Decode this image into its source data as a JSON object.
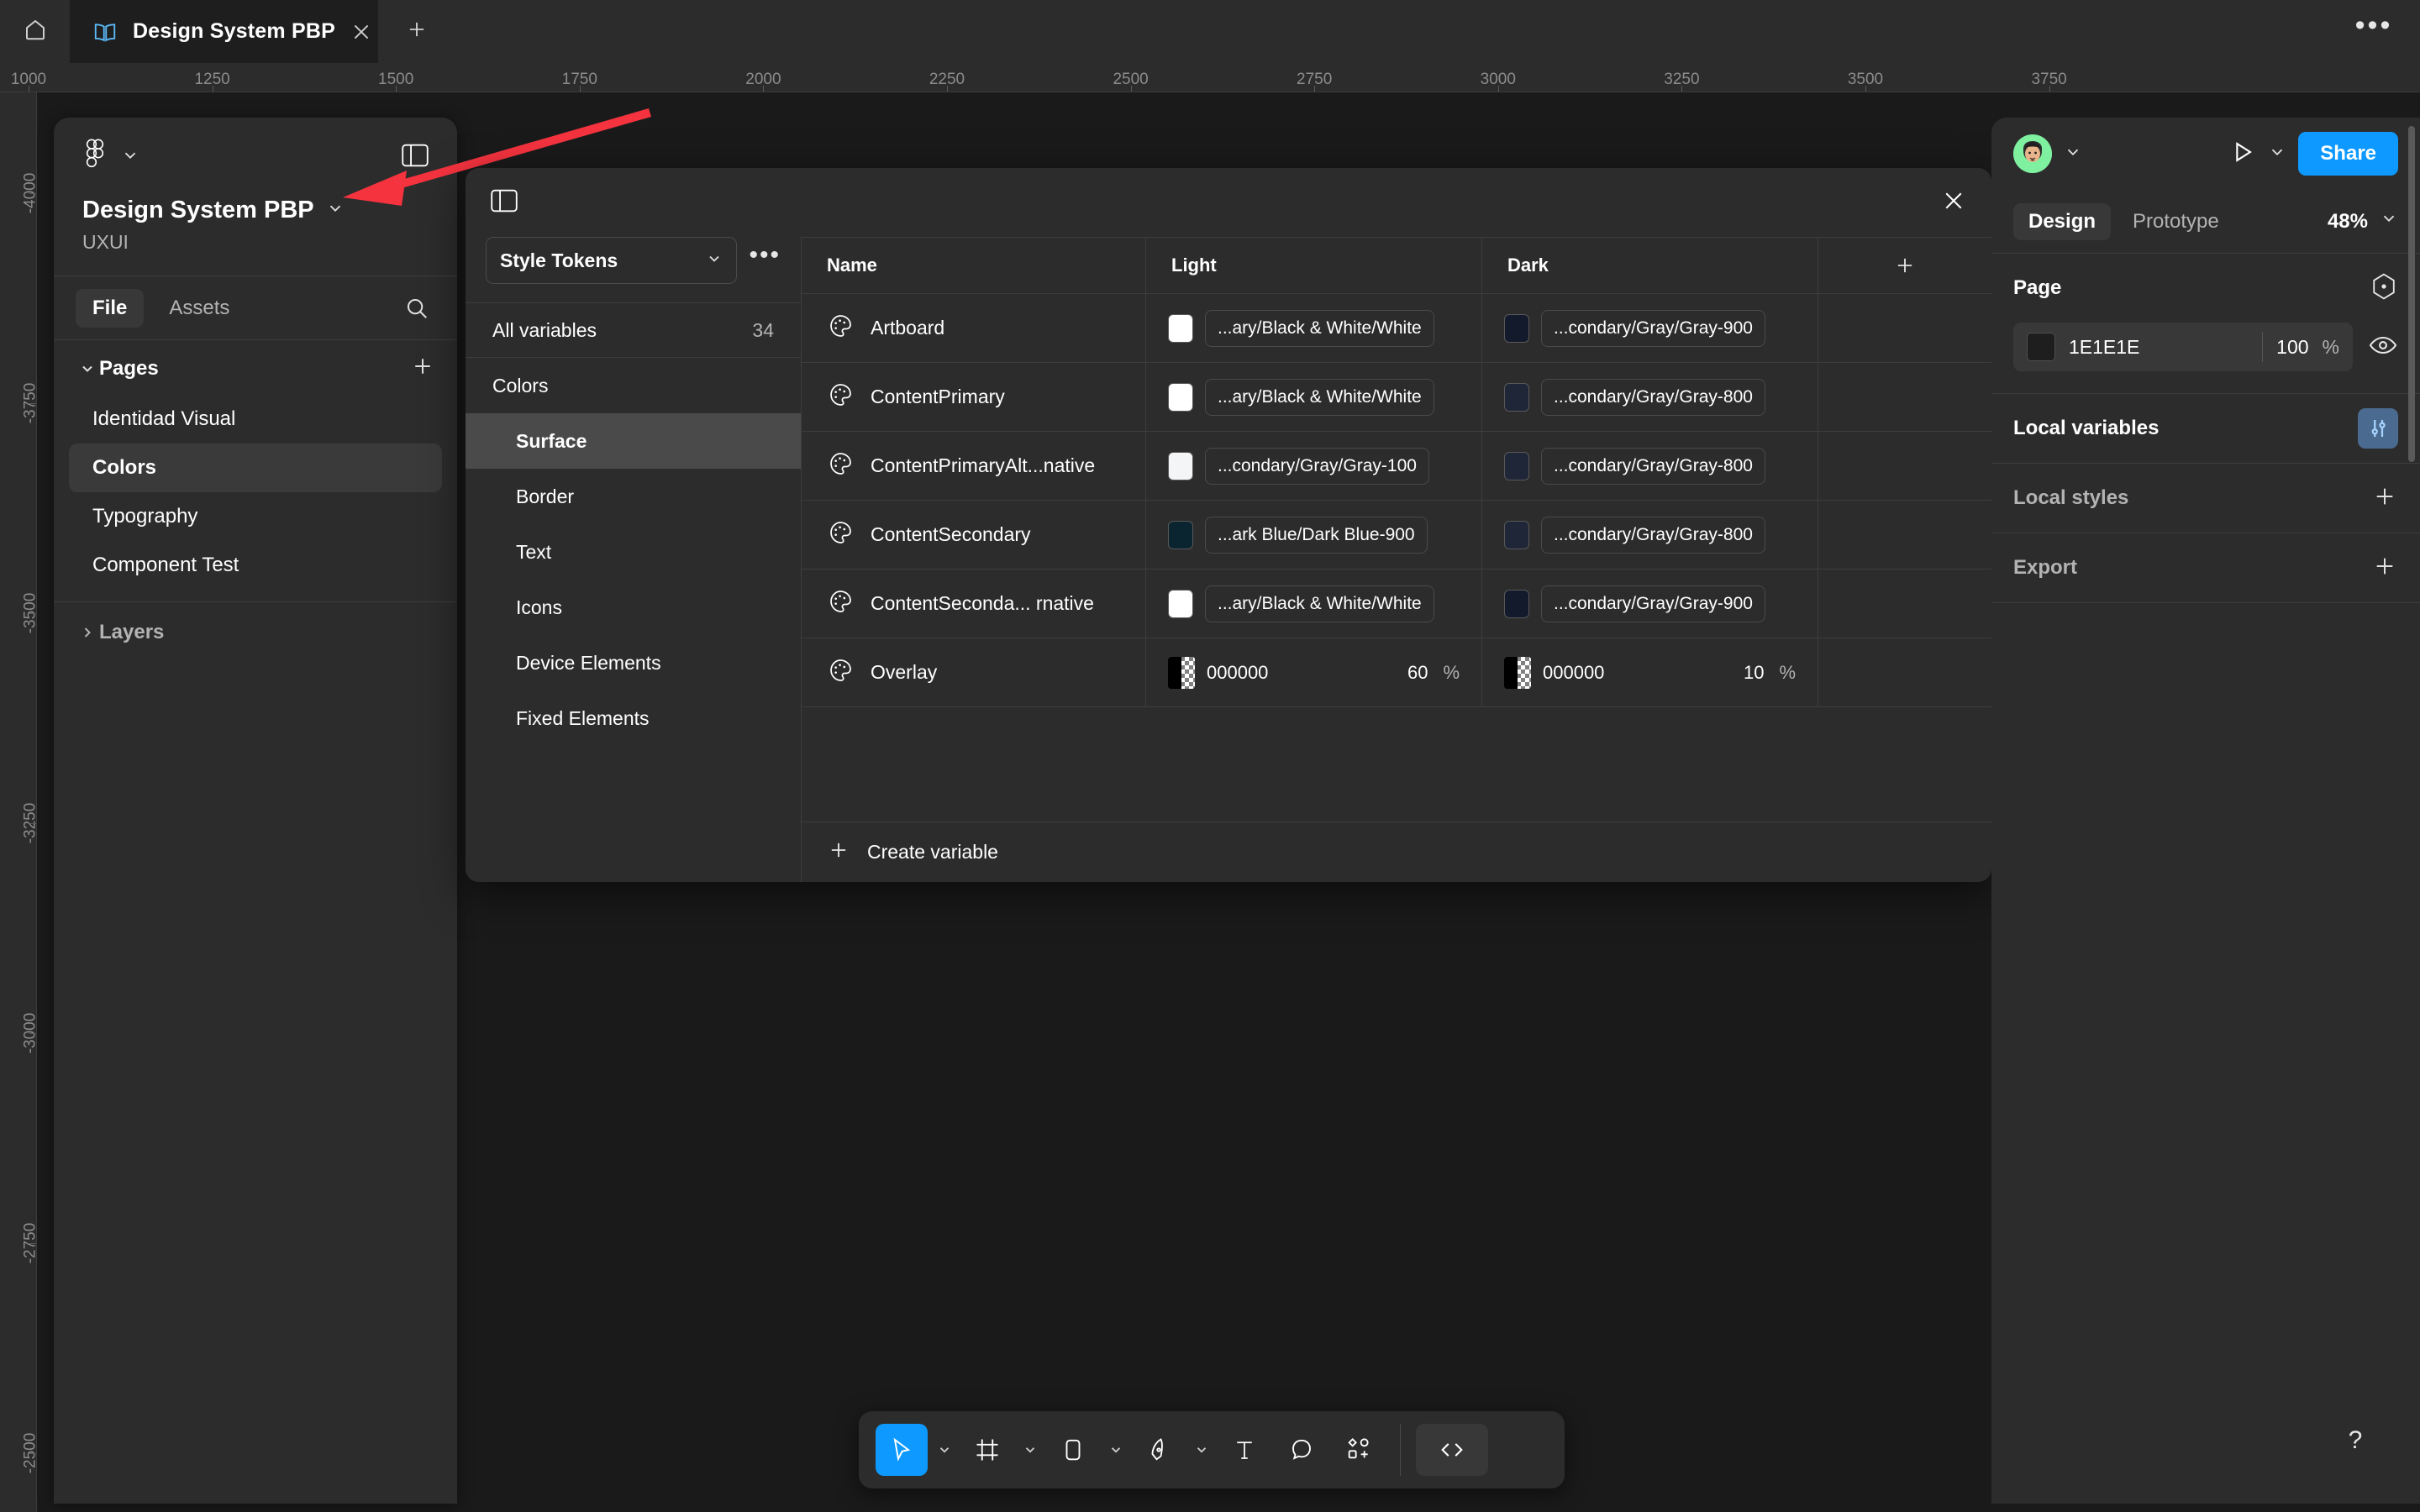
{
  "topbar": {
    "home_icon": "home-icon",
    "tab": {
      "icon": "file-book-icon",
      "title": "Design System PBP",
      "close_icon": "close-icon"
    },
    "new_tab_icon": "plus-icon",
    "more_icon": "more-horizontal-icon"
  },
  "rulers": {
    "horizontal": [
      "1000",
      "1250",
      "1500",
      "1750",
      "2000",
      "2250",
      "2500",
      "2750",
      "3000",
      "3250",
      "3500",
      "3750"
    ],
    "vertical": [
      "-4000",
      "-3750",
      "-3500",
      "-3250",
      "-3000",
      "-2750",
      "-2500"
    ]
  },
  "sidebar": {
    "logo_icon": "figma-logo-icon",
    "logo_caret_icon": "chevron-down-icon",
    "panel_toggle_icon": "panel-layout-icon",
    "file_title": "Design System PBP",
    "file_title_caret_icon": "chevron-down-icon",
    "subtitle": "UXUI",
    "tabs": [
      {
        "label": "File",
        "active": true
      },
      {
        "label": "Assets",
        "active": false
      }
    ],
    "search_icon": "search-icon",
    "pages_section": {
      "label": "Pages",
      "caret_icon": "chevron-down-icon",
      "add_icon": "plus-icon"
    },
    "pages": [
      {
        "label": "Identidad Visual",
        "active": false
      },
      {
        "label": "Colors",
        "active": true
      },
      {
        "label": "Typography",
        "active": false
      },
      {
        "label": "Component Test",
        "active": false
      }
    ],
    "layers_section": {
      "label": "Layers",
      "caret_icon": "chevron-right-icon"
    }
  },
  "modal": {
    "panel_toggle_icon": "sidebar-toggle-icon",
    "close_icon": "close-icon",
    "collection": {
      "name": "Style Tokens",
      "caret_icon": "chevron-down-icon"
    },
    "more_icon": "more-horizontal-icon",
    "all_variables": {
      "label": "All variables",
      "count": "34"
    },
    "groups": [
      {
        "label": "Colors",
        "sub": false,
        "active": false
      },
      {
        "label": "Surface",
        "sub": true,
        "active": true
      },
      {
        "label": "Border",
        "sub": true,
        "active": false
      },
      {
        "label": "Text",
        "sub": true,
        "active": false
      },
      {
        "label": "Icons",
        "sub": true,
        "active": false
      },
      {
        "label": "Device Elements",
        "sub": true,
        "active": false
      },
      {
        "label": "Fixed Elements",
        "sub": true,
        "active": false
      }
    ],
    "table": {
      "columns": [
        "Name",
        "Light",
        "Dark"
      ],
      "add_column_icon": "plus-icon",
      "rows": [
        {
          "icon": "palette-icon",
          "name": "Artboard",
          "light": {
            "kind": "alias",
            "swatch": "#ffffff",
            "label": "...ary/Black & White/White"
          },
          "dark": {
            "kind": "alias",
            "swatch": "#131a2b",
            "label": "...condary/Gray/Gray-900"
          }
        },
        {
          "icon": "palette-icon",
          "name": "ContentPrimary",
          "light": {
            "kind": "alias",
            "swatch": "#ffffff",
            "label": "...ary/Black & White/White"
          },
          "dark": {
            "kind": "alias",
            "swatch": "#1e2638",
            "label": "...condary/Gray/Gray-800"
          }
        },
        {
          "icon": "palette-icon",
          "name": "ContentPrimaryAlt...native",
          "light": {
            "kind": "alias",
            "swatch": "#f4f5f7",
            "label": "...condary/Gray/Gray-100"
          },
          "dark": {
            "kind": "alias",
            "swatch": "#1e2638",
            "label": "...condary/Gray/Gray-800"
          }
        },
        {
          "icon": "palette-icon",
          "name": "ContentSecondary",
          "light": {
            "kind": "alias",
            "swatch": "#0a2430",
            "label": "...ark Blue/Dark Blue-900"
          },
          "dark": {
            "kind": "alias",
            "swatch": "#1e2638",
            "label": "...condary/Gray/Gray-800"
          }
        },
        {
          "icon": "palette-icon",
          "name": "ContentSeconda... rnative",
          "light": {
            "kind": "alias",
            "swatch": "#ffffff",
            "label": "...ary/Black & White/White"
          },
          "dark": {
            "kind": "alias",
            "swatch": "#131a2b",
            "label": "...condary/Gray/Gray-900"
          }
        },
        {
          "icon": "palette-icon",
          "name": "Overlay",
          "light": {
            "kind": "hex",
            "hex": "000000",
            "opacity": "60",
            "pct": "%"
          },
          "dark": {
            "kind": "hex",
            "hex": "000000",
            "opacity": "10",
            "pct": "%"
          }
        }
      ]
    },
    "footer": {
      "add_icon": "plus-icon",
      "label": "Create variable"
    }
  },
  "right_panel": {
    "avatar": "user-avatar",
    "avatar_caret_icon": "chevron-down-icon",
    "present_icon": "play-icon",
    "present_caret_icon": "chevron-down-icon",
    "share_label": "Share",
    "tabs": [
      {
        "label": "Design",
        "active": true
      },
      {
        "label": "Prototype",
        "active": false
      }
    ],
    "zoom": {
      "value": "48%",
      "caret_icon": "chevron-down-icon"
    },
    "page_section": {
      "title": "Page",
      "settings_icon": "page-settings-icon",
      "color": {
        "hex": "1E1E1E",
        "opacity": "100",
        "pct": "%",
        "visibility_icon": "eye-icon"
      }
    },
    "local_variables": {
      "title": "Local variables",
      "icon": "variables-sliders-icon"
    },
    "local_styles": {
      "title": "Local styles",
      "add_icon": "plus-icon"
    },
    "export": {
      "title": "Export",
      "add_icon": "plus-icon"
    }
  },
  "toolbar": {
    "tools": [
      {
        "name": "move-tool",
        "icon": "cursor-icon",
        "active": true,
        "caret": true
      },
      {
        "name": "frame-tool",
        "icon": "frame-icon",
        "active": false,
        "caret": true
      },
      {
        "name": "shape-tool",
        "icon": "rectangle-icon",
        "active": false,
        "caret": true
      },
      {
        "name": "pen-tool",
        "icon": "pen-icon",
        "active": false,
        "caret": true
      },
      {
        "name": "text-tool",
        "icon": "text-icon",
        "active": false,
        "caret": false
      },
      {
        "name": "comment-tool",
        "icon": "comment-icon",
        "active": false,
        "caret": false
      },
      {
        "name": "actions-tool",
        "icon": "components-icon",
        "active": false,
        "caret": false
      }
    ],
    "dev_mode": {
      "name": "dev-mode-toggle",
      "icon": "code-icon"
    }
  },
  "help": {
    "label": "?"
  },
  "colors": {
    "accent": "#0d99ff",
    "panel_bg": "#2c2c2c",
    "canvas_bg": "#1a1a1a",
    "arrow": "#f5333f"
  }
}
